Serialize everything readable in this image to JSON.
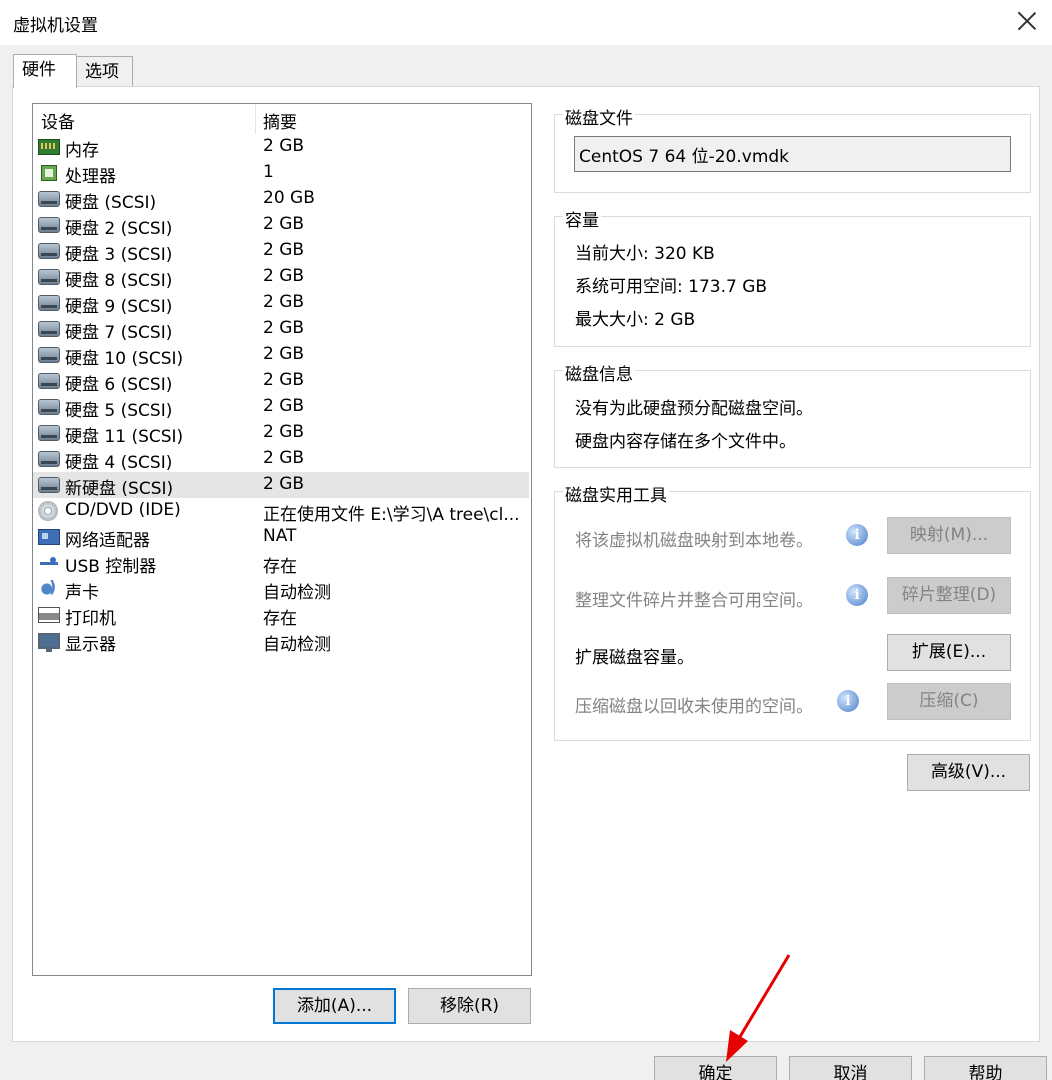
{
  "window": {
    "title": "虚拟机设置"
  },
  "tabs": [
    {
      "label": "硬件"
    },
    {
      "label": "选项"
    }
  ],
  "devices": {
    "header_device": "设备",
    "header_summary": "摘要",
    "rows": [
      {
        "name": "内存",
        "summary": "2 GB",
        "icon": "memory-icon"
      },
      {
        "name": "处理器",
        "summary": "1",
        "icon": "processor-icon"
      },
      {
        "name": "硬盘 (SCSI)",
        "summary": "20 GB",
        "icon": "hard-disk-icon"
      },
      {
        "name": "硬盘 2 (SCSI)",
        "summary": "2 GB",
        "icon": "hard-disk-icon"
      },
      {
        "name": "硬盘 3 (SCSI)",
        "summary": "2 GB",
        "icon": "hard-disk-icon"
      },
      {
        "name": "硬盘 8 (SCSI)",
        "summary": "2 GB",
        "icon": "hard-disk-icon"
      },
      {
        "name": "硬盘 9 (SCSI)",
        "summary": "2 GB",
        "icon": "hard-disk-icon"
      },
      {
        "name": "硬盘 7 (SCSI)",
        "summary": "2 GB",
        "icon": "hard-disk-icon"
      },
      {
        "name": "硬盘 10 (SCSI)",
        "summary": "2 GB",
        "icon": "hard-disk-icon"
      },
      {
        "name": "硬盘 6 (SCSI)",
        "summary": "2 GB",
        "icon": "hard-disk-icon"
      },
      {
        "name": "硬盘 5 (SCSI)",
        "summary": "2 GB",
        "icon": "hard-disk-icon"
      },
      {
        "name": "硬盘 11 (SCSI)",
        "summary": "2 GB",
        "icon": "hard-disk-icon"
      },
      {
        "name": "硬盘 4 (SCSI)",
        "summary": "2 GB",
        "icon": "hard-disk-icon"
      },
      {
        "name": "新硬盘 (SCSI)",
        "summary": "2 GB",
        "icon": "hard-disk-icon",
        "selected": true
      },
      {
        "name": "CD/DVD (IDE)",
        "summary": "正在使用文件 E:\\学习\\A tree\\cl...",
        "icon": "cd-dvd-icon"
      },
      {
        "name": "网络适配器",
        "summary": "NAT",
        "icon": "network-adapter-icon"
      },
      {
        "name": "USB 控制器",
        "summary": "存在",
        "icon": "usb-icon"
      },
      {
        "name": "声卡",
        "summary": "自动检测",
        "icon": "sound-card-icon"
      },
      {
        "name": "打印机",
        "summary": "存在",
        "icon": "printer-icon"
      },
      {
        "name": "显示器",
        "summary": "自动检测",
        "icon": "display-icon"
      }
    ],
    "add_button": "添加(A)...",
    "remove_button": "移除(R)"
  },
  "disk_file": {
    "label": "磁盘文件",
    "value": "CentOS 7 64 位-20.vmdk"
  },
  "capacity": {
    "label": "容量",
    "current_size": "当前大小: 320 KB",
    "available_space": "系统可用空间: 173.7 GB",
    "max_size": "最大大小: 2 GB"
  },
  "disk_info": {
    "label": "磁盘信息",
    "line1": "没有为此硬盘预分配磁盘空间。",
    "line2": "硬盘内容存储在多个文件中。"
  },
  "utilities": {
    "label": "磁盘实用工具",
    "map_text": "将该虚拟机磁盘映射到本地卷。",
    "map_button": "映射(M)...",
    "defrag_text": "整理文件碎片并整合可用空间。",
    "defrag_button": "碎片整理(D)",
    "expand_text": "扩展磁盘容量。",
    "expand_button": "扩展(E)...",
    "compact_text": "压缩磁盘以回收未使用的空间。",
    "compact_button": "压缩(C)"
  },
  "advanced_button": "高级(V)...",
  "footer": {
    "ok": "确定",
    "cancel": "取消",
    "help": "帮助"
  },
  "colors": {
    "accent": "#0078d7",
    "selection": "#e5e5e5",
    "arrow": "#e60000"
  }
}
